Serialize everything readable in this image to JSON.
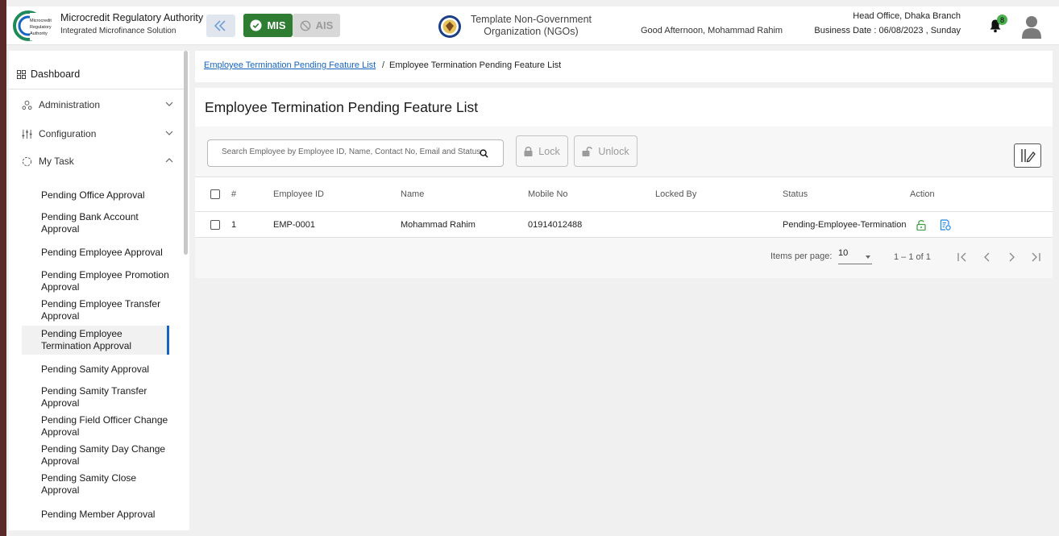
{
  "header": {
    "brand_title": "Microcredit Regulatory Authority",
    "brand_subtitle": "Integrated Microfinance Solution",
    "logo_text": [
      "Microcredit",
      "Regulatory",
      "Authority"
    ],
    "mis_label": "MIS",
    "ais_label": "AIS",
    "org_name": "Template Non-Government Organization (NGOs)",
    "greeting": "Good Afternoon, Mohammad Rahim",
    "branch": "Head Office, Dhaka Branch",
    "business_date": "Business Date : 06/08/2023 , Sunday",
    "notification_count": "8",
    "colors": {
      "mis": "#2e7d32",
      "accent": "#1565c0",
      "badge": "#4caf50"
    }
  },
  "sidebar": {
    "dashboard": "Dashboard",
    "groups": {
      "administration": "Administration",
      "configuration": "Configuration",
      "my_task": "My Task"
    },
    "my_task_items": [
      {
        "label": "Pending Office Approval"
      },
      {
        "label": "Pending Bank Account Approval"
      },
      {
        "label": "Pending Employee Approval"
      },
      {
        "label": "Pending Employee Promotion Approval"
      },
      {
        "label": "Pending Employee Transfer Approval"
      },
      {
        "label": "Pending Employee Termination Approval",
        "active": true
      },
      {
        "label": "Pending Samity Approval"
      },
      {
        "label": "Pending Samity Transfer Approval"
      },
      {
        "label": "Pending Field Officer Change Approval"
      },
      {
        "label": "Pending Samity Day Change Approval"
      },
      {
        "label": "Pending Samity Close Approval"
      },
      {
        "label": "Pending Member Approval"
      }
    ]
  },
  "breadcrumb": {
    "link": "Employee Termination Pending Feature List",
    "separator": "/",
    "current": "Employee Termination Pending Feature List"
  },
  "main": {
    "title": "Employee Termination Pending Feature List",
    "search_placeholder": "Search Employee by Employee ID, Name, Contact No, Email and Status",
    "lock_label": "Lock",
    "unlock_label": "Unlock",
    "columns": [
      "#",
      "Employee ID",
      "Name",
      "Mobile No",
      "Locked By",
      "Status",
      "Action"
    ],
    "rows": [
      {
        "no": "1",
        "employee_id": "EMP-0001",
        "name": "Mohammad Rahim",
        "mobile": "01914012488",
        "locked_by": "",
        "status": "Pending-Employee-Termination"
      }
    ],
    "paginator": {
      "items_per_page_label": "Items per page:",
      "page_size": "10",
      "range": "1 – 1 of 1"
    }
  }
}
